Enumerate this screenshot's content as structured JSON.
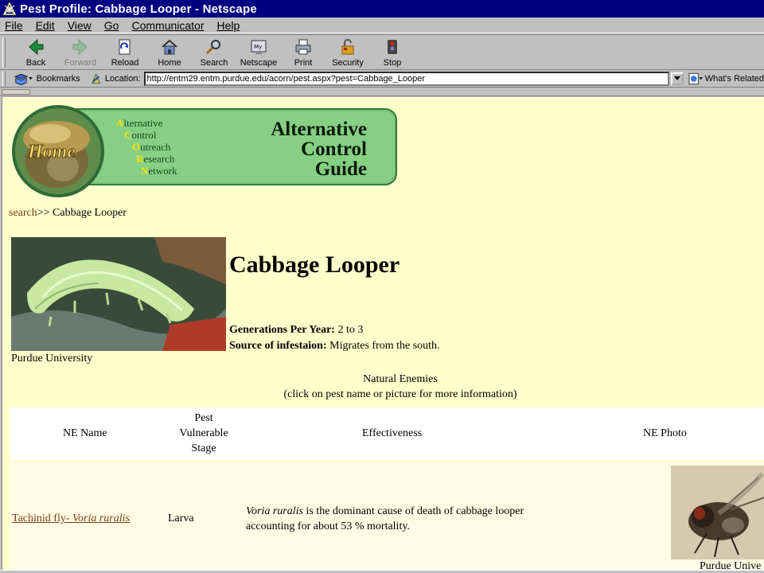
{
  "window": {
    "title": "Pest Profile: Cabbage Looper - Netscape"
  },
  "menu": [
    "File",
    "Edit",
    "View",
    "Go",
    "Communicator",
    "Help"
  ],
  "toolbar": {
    "back": "Back",
    "forward": "Forward",
    "reload": "Reload",
    "home": "Home",
    "search": "Search",
    "netscape": "Netscape",
    "print": "Print",
    "security": "Security",
    "stop": "Stop"
  },
  "location_bar": {
    "bookmarks_label": "Bookmarks",
    "location_label": "Location:",
    "url": "http://entm29.entm.purdue.edu/acorn/pest.aspx?pest=Cabbage_Looper",
    "related_label": "What's Related"
  },
  "banner": {
    "home_label": "Home",
    "acronym": [
      {
        "letter": "A",
        "rest": "lternative"
      },
      {
        "letter": "C",
        "rest": "ontrol"
      },
      {
        "letter": "O",
        "rest": "utreach"
      },
      {
        "letter": "R",
        "rest": "esearch"
      },
      {
        "letter": "N",
        "rest": "etwork"
      }
    ],
    "guide_title": [
      "Alternative",
      "Control",
      "Guide"
    ]
  },
  "breadcrumb": {
    "link": "search",
    "current": ">> Cabbage Looper"
  },
  "pest": {
    "name": "Cabbage Looper",
    "photo_credit": "Purdue University",
    "generations_label": "Generations Per Year:",
    "generations_value": "2 to 3",
    "source_label": "Source of infestaion:",
    "source_value": "Migrates from the south."
  },
  "natural_enemies": {
    "title": "Natural Enemies",
    "subtitle": "(click on pest name or picture for more information)",
    "headers": {
      "name": "NE Name",
      "stage_lines": [
        "Pest",
        "Vulnerable",
        "Stage"
      ],
      "effectiveness": "Effectiveness",
      "photo": "NE Photo"
    },
    "rows": [
      {
        "common_name": "Tachinid fly- ",
        "scientific_name": "Voria ruralis",
        "stage": "Larva",
        "effect_sci": "Voria ruralis",
        "effect_text": " is the dominant cause of death of cabbage looper accounting for about 53 % mortality.",
        "photo_credit": "Purdue Unive"
      }
    ]
  }
}
